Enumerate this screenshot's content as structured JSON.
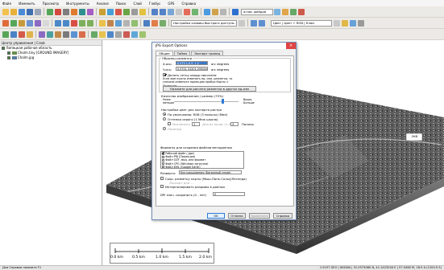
{
  "menubar": [
    "Файл",
    "Изменить",
    "Просмотр",
    "Инструменты",
    "Анализ",
    "Поиск",
    "Слой",
    "Глобус",
    "GPS",
    "Справка"
  ],
  "toolbar": {
    "projection_text": "Настройка клавиш быстрого доступа...",
    "source_text": "Цвет | Цвет + RGB | Ключ",
    "search_text": "атлас шейдов"
  },
  "left_panel": {
    "title": "Центр управления | Слой",
    "root_label": "Липецкая рабочая область",
    "layers": [
      "Cholm.tiny [GROUND IMAGERY]",
      "Cholm.jpg"
    ]
  },
  "map": {
    "label_tag": "ОКВ",
    "scale_ticks": [
      "0.0 km",
      "0.5 km",
      "1.0 km",
      "1.5 km",
      "2.0 km"
    ]
  },
  "statusbar": {
    "left": "Для Справки нажмите F1",
    "right": "1:5197 GEO | WGS84 | 31.5573060 N, 41.1423204 E | 57.5460 M, 18.9 A (1200.0 S)"
  },
  "dialog": {
    "title": "JPG Export Options",
    "close_glyph": "×",
    "tabs": [
      "Общие",
      "Тайлы",
      "Экспорт границ"
    ],
    "active_tab": "Общие",
    "sample_spacing_label": "Образец разметки",
    "x_label": "X-ось:",
    "x_value": "0.573 1.0 0. 1.2",
    "x_unit": "arc degrees",
    "y_label": "Y-ось:",
    "y_value": "0.5701 31201.20004е-0Х",
    "y_unit": "arc degrees",
    "keep_pixels_square": "Делать сетку квадр пикселем",
    "hint_text": "Если вам нужно изменить ед. изм. разметки, то сначала измените проекцию пробуя Карты > Проекция",
    "calc_spacing_button": "Нажмите для расчета разметки в других ед.изм",
    "quality_label": "Качество изображения / размер (75%)",
    "quality_low": "Ниже",
    "quality_low2": "меньше",
    "quality_high": "Выше,",
    "quality_high2": "Больше",
    "quality_fraction": 0.75,
    "palette_label": "Настройки цвет для экспорта растра",
    "rgb_option": "По умолчанию: RGB (3 полосы) (Мин)",
    "gray_option": "Оттенки серого (1 Меж шкала)",
    "range_label": "Исключить",
    "bands_label": "Для из полос (1-9)",
    "band_value": "1",
    "band_value2": "3",
    "bands_unit": "Полосы",
    "palette_option": "Палитра",
    "metadata_label": "Форматы для создания файлов метаданных",
    "metadata_items": [
      "Рабочий файл (.jgw)",
      "Файл PRJ (Проекция)",
      "Файл OZF, мод. или формат",
      "Файл CPG (Windows загрузки)",
      "Файл KML (Google Earth)"
    ],
    "resolution_label": "Развертк:",
    "resolution_value": "Без расширения (Бинарный сплав)",
    "save_grid": "Сохр. разметку карты (Мыш-Папк-Солы)/Легенда)",
    "save_grid2": "Экспорт для ...",
    "interpolate": "Интерполировать разрывы в данных",
    "dpi_label": "DPI знач. сохранить (0 - нет)",
    "dpi_value": "0",
    "ok": "OK",
    "cancel": "Отмена",
    "apply": "Применить",
    "help": "Справка"
  },
  "colors": {
    "accent": "#2d7ad6",
    "close": "#e04343",
    "selection": "#3c78c8"
  }
}
